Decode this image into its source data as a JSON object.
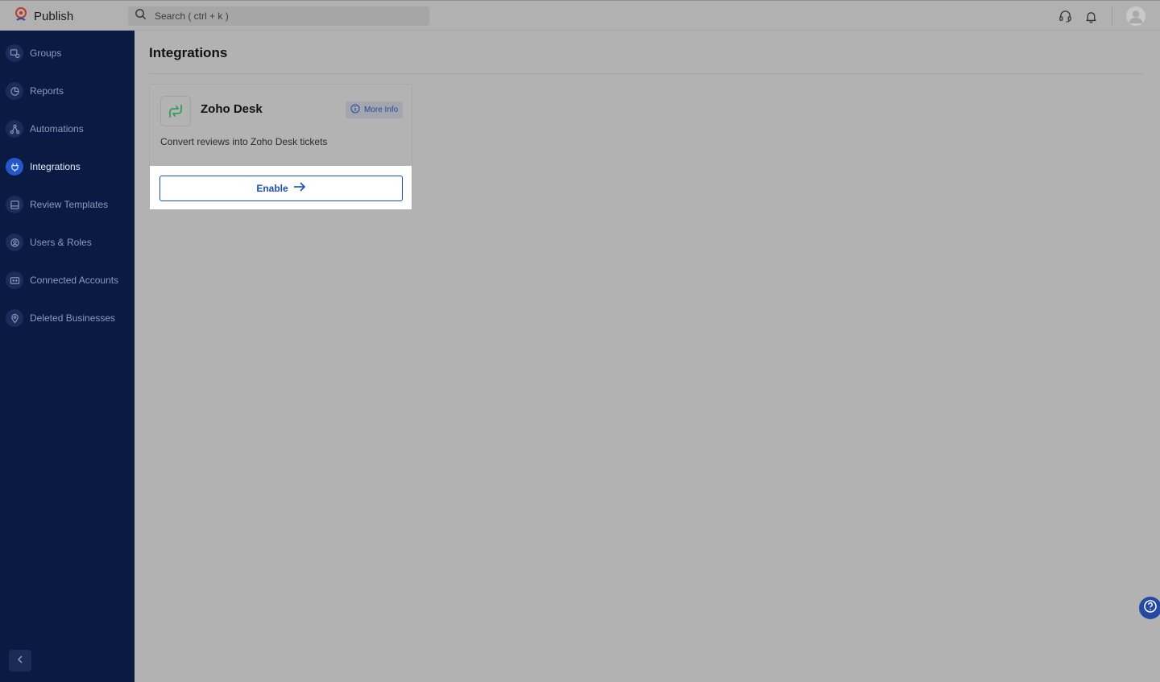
{
  "app": {
    "name": "Publish"
  },
  "search": {
    "placeholder": "Search ( ctrl + k )"
  },
  "sidebar": {
    "items": [
      {
        "label": "Groups",
        "icon": "groups-icon",
        "active": false
      },
      {
        "label": "Reports",
        "icon": "reports-icon",
        "active": false
      },
      {
        "label": "Automations",
        "icon": "automations-icon",
        "active": false
      },
      {
        "label": "Integrations",
        "icon": "integrations-icon",
        "active": true
      },
      {
        "label": "Review Templates",
        "icon": "review-templates-icon",
        "active": false
      },
      {
        "label": "Users & Roles",
        "icon": "users-roles-icon",
        "active": false
      },
      {
        "label": "Connected Accounts",
        "icon": "connected-accounts-icon",
        "active": false
      },
      {
        "label": "Deleted Businesses",
        "icon": "deleted-businesses-icon",
        "active": false
      }
    ]
  },
  "main": {
    "title": "Integrations",
    "integrations": [
      {
        "name": "Zoho Desk",
        "description": "Convert reviews into Zoho Desk tickets",
        "more_info_label": "More Info",
        "enable_label": "Enable"
      }
    ]
  },
  "colors": {
    "sidebar_bg": "#0a1a42",
    "accent": "#1c4fb5",
    "active_nav": "#2457c7",
    "overlay_gray": "#b2b2b2",
    "logo_green": "#2e9e5b"
  }
}
